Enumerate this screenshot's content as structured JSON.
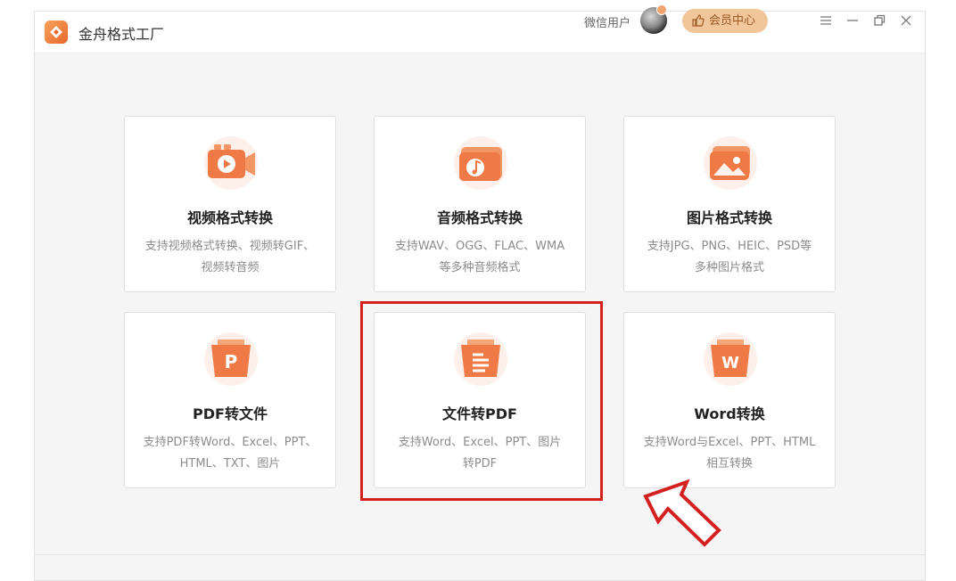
{
  "titlebar": {
    "app_name": "金舟格式工厂",
    "user_name": "微信用户",
    "vip_label": "会员中心",
    "controls": [
      "menu-icon",
      "minimize-icon",
      "restore-icon",
      "close-icon"
    ]
  },
  "cards": [
    {
      "title": "视频格式转换",
      "desc_line1": "支持视频格式转换、视频转GIF、",
      "desc_line2": "视频转音频",
      "icon": "video-icon"
    },
    {
      "title": "音频格式转换",
      "desc_line1": "支持WAV、OGG、FLAC、WMA",
      "desc_line2": "等多种音频格式",
      "icon": "audio-icon"
    },
    {
      "title": "图片格式转换",
      "desc_line1": "支持JPG、PNG、HEIC、PSD等",
      "desc_line2": "多种图片格式",
      "icon": "image-icon"
    },
    {
      "title": "PDF转文件",
      "desc_line1": "支持PDF转Word、Excel、PPT、",
      "desc_line2": "HTML、TXT、图片",
      "icon": "pdf-icon",
      "glyph": "P"
    },
    {
      "title": "文件转PDF",
      "desc_line1": "支持Word、Excel、PPT、图片",
      "desc_line2": "转PDF",
      "icon": "document-icon"
    },
    {
      "title": "Word转换",
      "desc_line1": "支持Word与Excel、PPT、HTML",
      "desc_line2": "相互转换",
      "icon": "word-icon",
      "glyph": "W"
    }
  ],
  "colors": {
    "accent": "#ee6a36",
    "highlight": "#d3211f",
    "vip_bg": "#f2c69b"
  }
}
